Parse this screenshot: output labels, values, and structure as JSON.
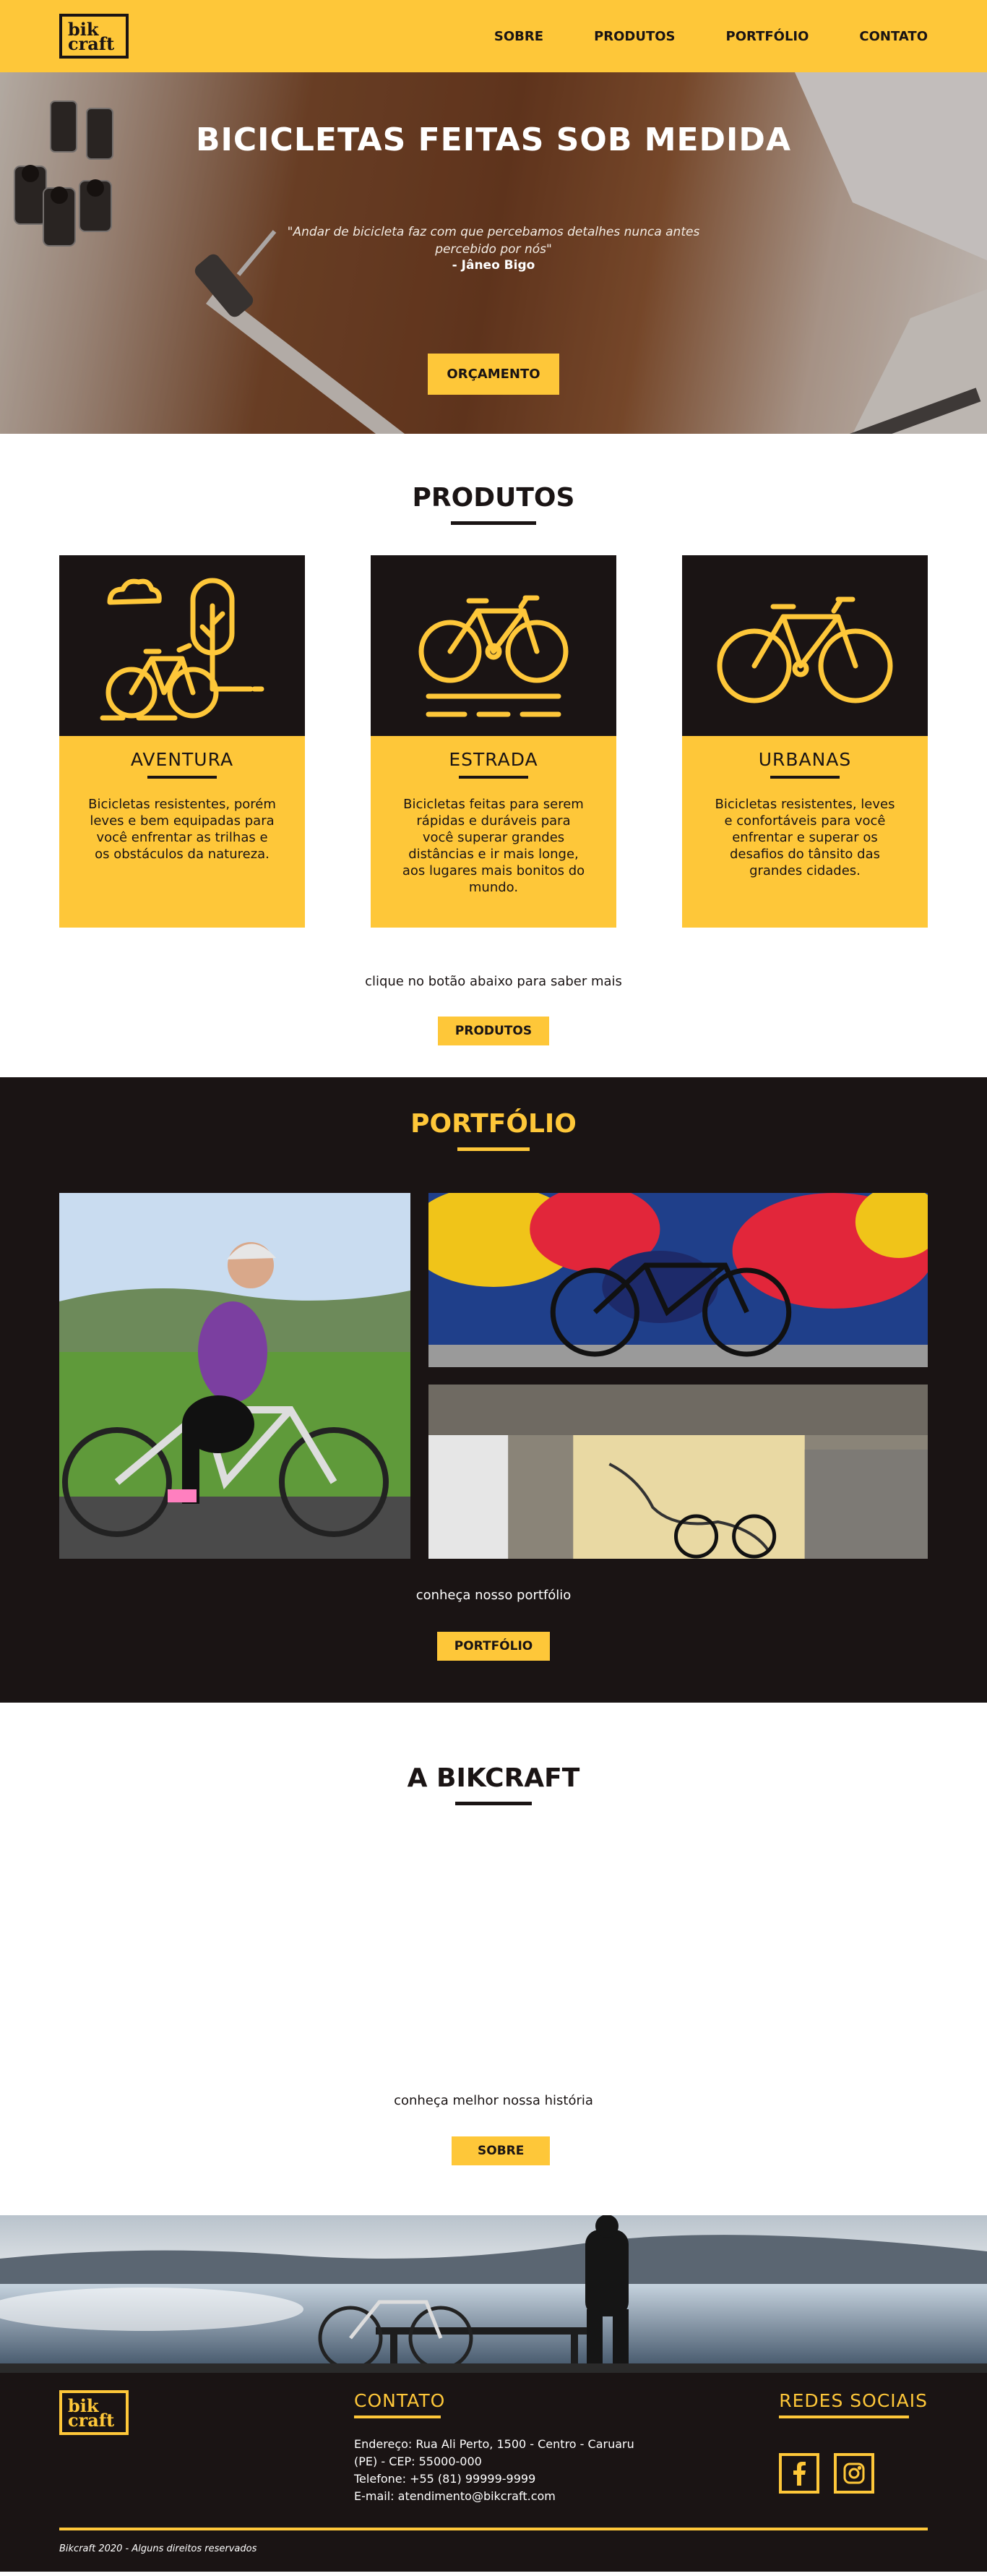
{
  "brand": {
    "logo_line1": "bik",
    "logo_line2": "craft"
  },
  "nav": {
    "items": [
      {
        "label": "SOBRE"
      },
      {
        "label": "PRODUTOS"
      },
      {
        "label": "PORTFÓLIO"
      },
      {
        "label": "CONTATO"
      }
    ]
  },
  "hero": {
    "title": "BICICLETAS FEITAS SOB MEDIDA",
    "quote": "\"Andar de bicicleta faz com que percebamos detalhes nunca antes percebido por nós\"",
    "author": "- Jâneo Bigo",
    "button": "ORÇAMENTO"
  },
  "produtos": {
    "title": "PRODUTOS",
    "cards": [
      {
        "name": "AVENTURA",
        "text": "Bicicletas resistentes, porém leves e bem equipadas para você enfrentar as trilhas e os obstáculos da natureza.",
        "icon": "mountain-bike-icon"
      },
      {
        "name": "ESTRADA",
        "text": "Bicicletas feitas para serem rápidas e duráveis para você superar grandes distâncias e ir mais longe, aos lugares mais bonitos do mundo.",
        "icon": "road-bike-icon"
      },
      {
        "name": "URBANAS",
        "text": "Bicicletas resistentes, leves e confortáveis para você enfrentar e superar os desafios do tânsito das grandes cidades.",
        "icon": "urban-bike-icon"
      }
    ],
    "cta_text": "clique no botão abaixo para saber mais",
    "button": "PRODUTOS"
  },
  "portfolio": {
    "title": "PORTFÓLIO",
    "cta_text": "conheça nosso portfólio",
    "button": "PORTFÓLIO"
  },
  "about": {
    "title": "A BIKCRAFT",
    "cta_text": "conheça melhor nossa história",
    "button": "SOBRE"
  },
  "footer": {
    "contact_title": "CONTATO",
    "contact_lines": [
      "Endereço: Rua Ali Perto, 1500 - Centro - Caruaru",
      "(PE) - CEP: 55000-000",
      "Telefone: +55 (81) 99999-9999",
      "E-mail: atendimento@bikcraft.com"
    ],
    "social_title": "REDES SOCIAIS",
    "copyright": "Bikcraft 2020 - Alguns direitos reservados"
  },
  "colors": {
    "accent": "#fec739",
    "dark": "#1a1414",
    "white": "#ffffff"
  }
}
